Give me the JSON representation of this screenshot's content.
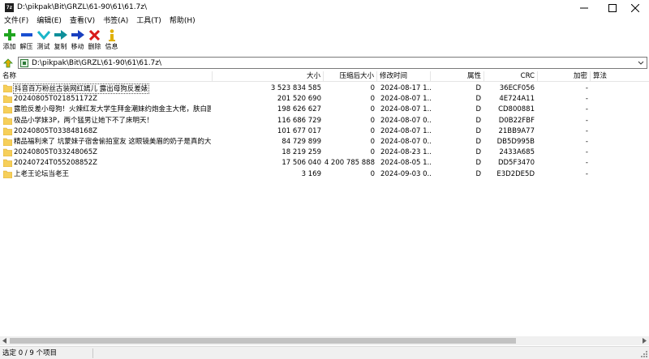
{
  "window": {
    "title": "D:\\pikpak\\Bit\\GRZL\\61-90\\61\\61.7z\\",
    "app_icon_text": "7z",
    "icon_names": [
      "minimize-icon",
      "maximize-icon",
      "close-icon"
    ]
  },
  "menu": [
    "文件(F)",
    "编辑(E)",
    "查看(V)",
    "书签(A)",
    "工具(T)",
    "帮助(H)"
  ],
  "toolbar": [
    {
      "label": "添加",
      "icon": "add-icon",
      "color": "#1fa51f"
    },
    {
      "label": "解压",
      "icon": "extract-icon",
      "color": "#1a4fd1"
    },
    {
      "label": "测试",
      "icon": "test-icon",
      "color": "#1ab6c9"
    },
    {
      "label": "复制",
      "icon": "copy-icon",
      "color": "#0e8f9a"
    },
    {
      "label": "移动",
      "icon": "move-icon",
      "color": "#1a3fbf"
    },
    {
      "label": "删除",
      "icon": "delete-icon",
      "color": "#d81a1a"
    },
    {
      "label": "信息",
      "icon": "info-icon",
      "color": "#e0b000"
    }
  ],
  "address": {
    "path": "D:\\pikpak\\Bit\\GRZL\\61-90\\61\\61.7z\\"
  },
  "columns": {
    "name": "名称",
    "size": "大小",
    "packed": "压缩后大小",
    "modified": "修改时间",
    "attributes": "属性",
    "crc": "CRC",
    "encrypted": "加密",
    "method": "算法"
  },
  "files": [
    {
      "name": "抖音百万粉丝古装网红嫣儿 露出母狗反差婊",
      "size": "3 523 834 585",
      "packed": "0",
      "modified": "2024-08-17 1...",
      "attr": "D",
      "crc": "36ECF056",
      "enc": "-"
    },
    {
      "name": "20240805T021851172Z",
      "size": "201 520 690",
      "packed": "0",
      "modified": "2024-08-07 1...",
      "attr": "D",
      "crc": "4E724A11",
      "enc": "-"
    },
    {
      "name": "露脸反差小母狗！火辣红发大学生拜金潮妹约炮金主大佬，肤白圆润光滑臀肥腰细，啪啪...",
      "size": "198 626 627",
      "packed": "0",
      "modified": "2024-08-07 1...",
      "attr": "D",
      "crc": "CD800881",
      "enc": "-"
    },
    {
      "name": "极品小学妹3P，两个猛男让她下不了床明天！",
      "size": "116 686 729",
      "packed": "0",
      "modified": "2024-08-07 0...",
      "attr": "D",
      "crc": "D0B22FBF",
      "enc": "-"
    },
    {
      "name": "20240805T033848168Z",
      "size": "101 677 017",
      "packed": "0",
      "modified": "2024-08-07 1...",
      "attr": "D",
      "crc": "21BB9A77",
      "enc": "-"
    },
    {
      "name": "精品福利来了 坑蒙妹子宿舍偷拍室友 这眼镜美眉的奶子是真的大啊 太刺激了",
      "size": "84 729 899",
      "packed": "0",
      "modified": "2024-08-07 0...",
      "attr": "D",
      "crc": "DB5D995B",
      "enc": "-"
    },
    {
      "name": "20240805T033248065Z",
      "size": "18 219 259",
      "packed": "0",
      "modified": "2024-08-23 1...",
      "attr": "D",
      "crc": "2433A685",
      "enc": "-"
    },
    {
      "name": "20240724T055208852Z",
      "size": "17 506 040",
      "packed": "4 200 785 888",
      "modified": "2024-08-05 1...",
      "attr": "D",
      "crc": "DD5F3470",
      "enc": "-"
    },
    {
      "name": "上老王论坛当老王",
      "size": "3 169",
      "packed": "0",
      "modified": "2024-09-03 0...",
      "attr": "D",
      "crc": "E3D2DE5D",
      "enc": "-"
    }
  ],
  "status": {
    "text": "选定 0 / 9 个项目"
  }
}
